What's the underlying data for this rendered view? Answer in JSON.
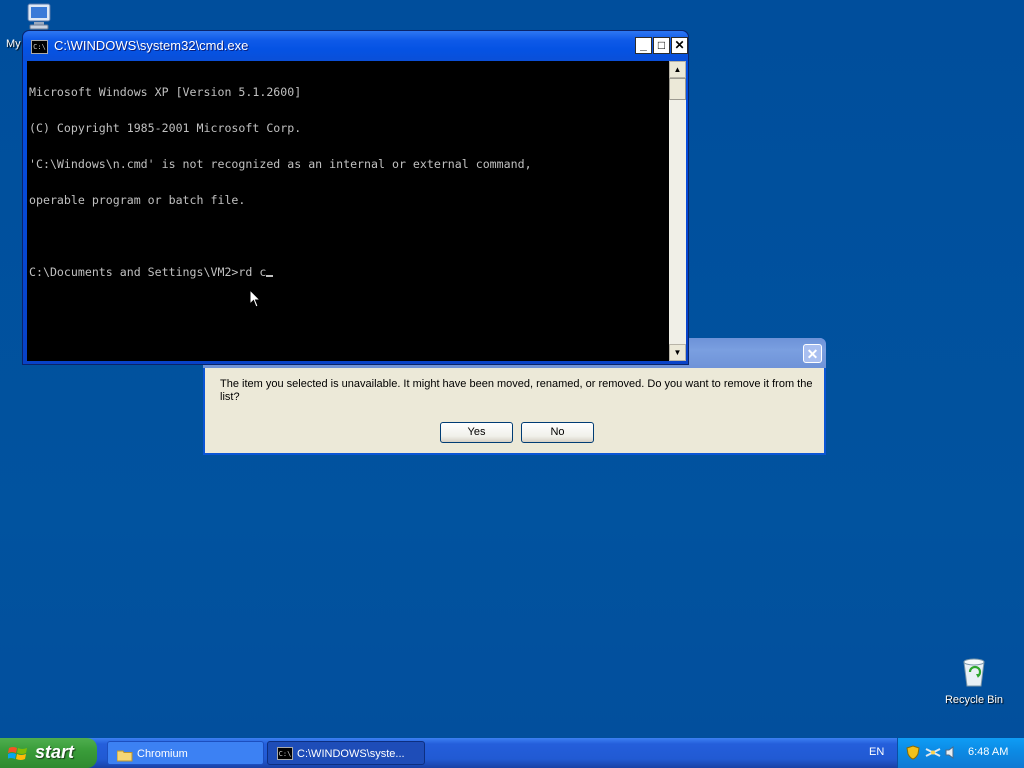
{
  "desktop": {
    "icons": [
      {
        "label": "My",
        "icon": "my-computer-icon"
      },
      {
        "label": "Recycle Bin",
        "icon": "recycle-bin-icon"
      }
    ]
  },
  "cmd_window": {
    "title": "C:\\WINDOWS\\system32\\cmd.exe",
    "lines": [
      "Microsoft Windows XP [Version 5.1.2600]",
      "(C) Copyright 1985-2001 Microsoft Corp.",
      "'C:\\Windows\\n.cmd' is not recognized as an internal or external command,",
      "operable program or batch file.",
      "",
      "C:\\Documents and Settings\\VM2>rd c"
    ],
    "buttons": {
      "minimize": "_",
      "maximize": "□",
      "close": "✕"
    }
  },
  "dialog": {
    "message": "The item you selected is unavailable.  It might have been moved, renamed, or removed.  Do you want to remove it from the list?",
    "yes_label": "Yes",
    "no_label": "No"
  },
  "taskbar": {
    "start_label": "start",
    "tasks": [
      {
        "label": "Chromium",
        "icon": "folder-icon"
      },
      {
        "label": "C:\\WINDOWS\\syste...",
        "icon": "cmd-icon"
      }
    ],
    "language": "EN",
    "clock": "6:48 AM"
  },
  "colors": {
    "desktop_bg": "#01509e",
    "title_bar": "#0553e4",
    "start_green": "#3a9d3a",
    "tray_blue": "#0c8ce6"
  }
}
